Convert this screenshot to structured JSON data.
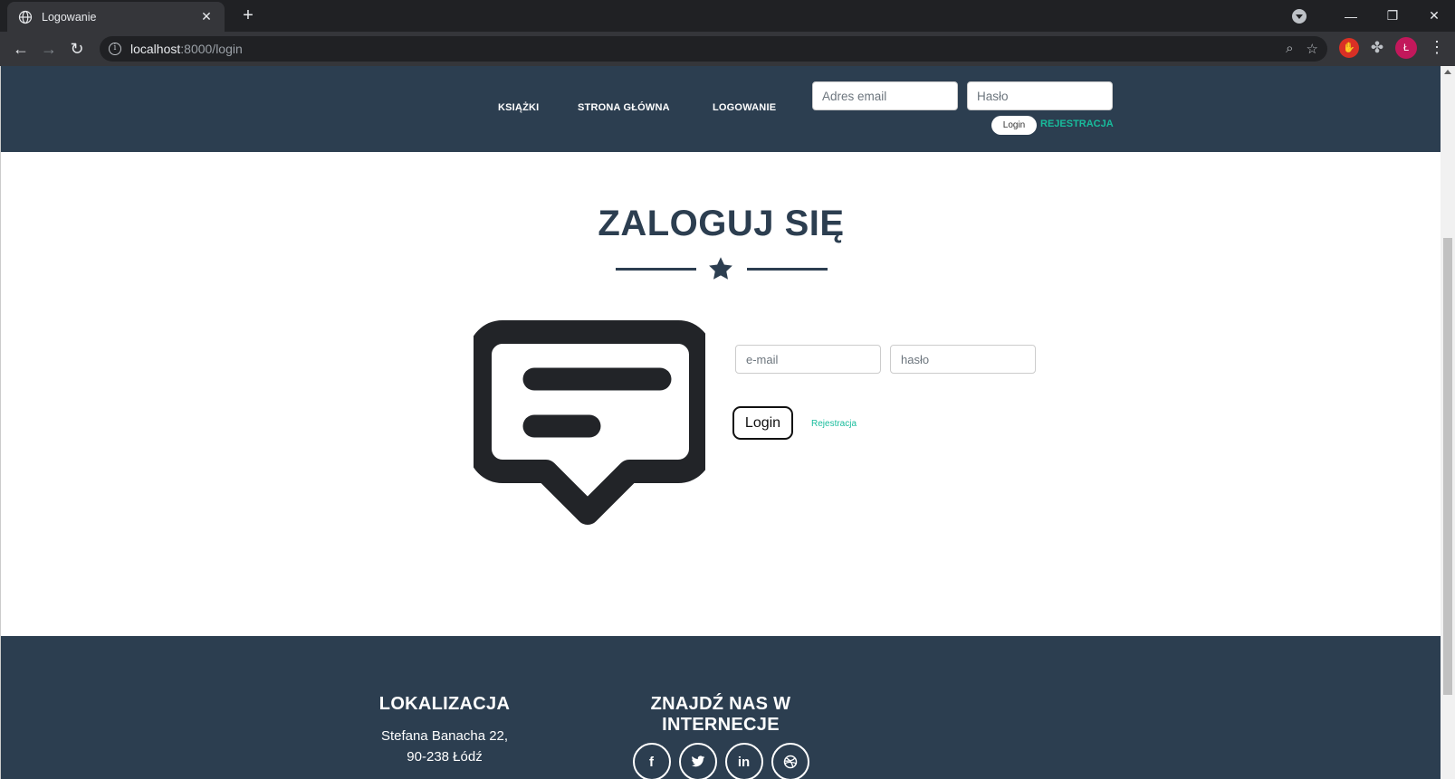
{
  "browser": {
    "tab_title": "Logowanie",
    "url_host": "localhost",
    "url_rest": ":8000/login",
    "avatar_letter": "Ł"
  },
  "navbar": {
    "links": [
      "KSIĄŻKI",
      "STRONA GŁÓWNA",
      "LOGOWANIE"
    ],
    "email_placeholder": "Adres email",
    "password_placeholder": "Hasło",
    "login_label": "Login",
    "register_label": "REJESTRACJA"
  },
  "main": {
    "heading": "ZALOGUJ SIĘ",
    "email_placeholder": "e-mail",
    "password_placeholder": "hasło",
    "login_label": "Login",
    "register_label": "Rejestracja"
  },
  "footer": {
    "location_title": "LOKALIZACJA",
    "address_line1": "Stefana Banacha 22,",
    "address_line2": "90-238 Łódź",
    "social_title_line1": "ZNAJDŹ NAS W",
    "social_title_line2": "INTERNECJE",
    "socials": [
      "facebook-icon",
      "twitter-icon",
      "linkedin-icon",
      "dribbble-icon"
    ]
  },
  "colors": {
    "primary": "#2c3e50",
    "accent": "#18bc9c"
  }
}
